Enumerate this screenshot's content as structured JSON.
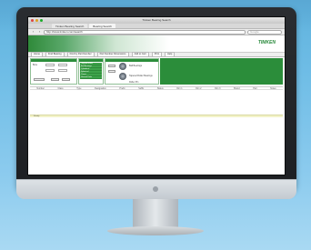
{
  "browser": {
    "window_title": "Timken Bearing Search",
    "tabs": [
      {
        "label": "Timken Bearing Search"
      },
      {
        "label": "Bearing Search"
      }
    ],
    "url": "http://www.timken.com/search",
    "search_placeholder": "Google"
  },
  "app": {
    "brand": "TIMKEN"
  },
  "toolbar": {
    "buttons": [
      "Home",
      "Find Bearing",
      "Find by Part Number",
      "Part Number Dimensions",
      "Add to Cart",
      "Print",
      "Help"
    ]
  },
  "panels": {
    "search_label": "Bore",
    "list_items": [
      "Tapered Roller",
      "Ball Bearings",
      "Cylindrical",
      "Spherical",
      "Thrust",
      "Housed Units"
    ],
    "results": [
      "Ball Bearings",
      "Tapered Roller Bearings",
      "Roller Pin"
    ]
  },
  "grid": {
    "columns": [
      "Number",
      "Class",
      "Type",
      "Designation",
      "Prefix",
      "Suffix",
      "Status",
      "Dim 1",
      "Dim 2",
      "Dim 3",
      "Brand",
      "Part",
      "Notes"
    ]
  },
  "status": {
    "text": "Ready"
  },
  "colors": {
    "brand_green": "#2b8d3a",
    "background": "#6fbde6"
  }
}
